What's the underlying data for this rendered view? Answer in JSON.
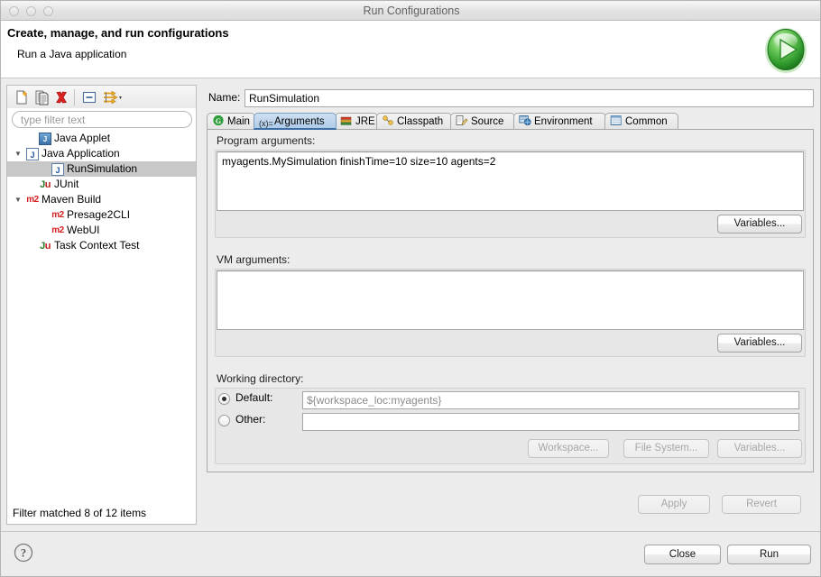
{
  "window": {
    "title": "Run Configurations",
    "traffic_lights": [
      "close",
      "minimize",
      "maximize"
    ]
  },
  "header": {
    "title": "Create, manage, and run configurations",
    "subtitle": "Run a Java application",
    "badge_icon": "run-play-icon"
  },
  "sidebar": {
    "toolbar": [
      {
        "name": "new-configuration-button",
        "icon": "new-document-icon"
      },
      {
        "name": "duplicate-configuration-button",
        "icon": "copy-icon"
      },
      {
        "name": "delete-configuration-button",
        "icon": "red-x-delete-icon"
      },
      {
        "name": "collapse-all-button",
        "icon": "collapse-all-icon"
      },
      {
        "name": "filter-menu-button",
        "icon": "filter-arrows-icon"
      }
    ],
    "filter": {
      "value": "",
      "placeholder": "type filter text"
    },
    "tree": [
      {
        "label": "Java Applet",
        "icon": "java-applet-icon",
        "indent": 1,
        "twisty": "",
        "selected": false
      },
      {
        "label": "Java Application",
        "icon": "java-app-icon",
        "indent": 0,
        "twisty": "▼",
        "selected": false
      },
      {
        "label": "RunSimulation",
        "icon": "java-app-icon",
        "indent": 2,
        "twisty": "",
        "selected": true
      },
      {
        "label": "JUnit",
        "icon": "junit-icon",
        "indent": 1,
        "twisty": "",
        "selected": false
      },
      {
        "label": "Maven Build",
        "icon": "maven-m2-icon",
        "indent": 0,
        "twisty": "▼",
        "selected": false
      },
      {
        "label": "Presage2CLI",
        "icon": "maven-m2-icon",
        "indent": 2,
        "twisty": "",
        "selected": false
      },
      {
        "label": "WebUI",
        "icon": "maven-m2-icon",
        "indent": 2,
        "twisty": "",
        "selected": false
      },
      {
        "label": "Task Context Test",
        "icon": "junit-icon",
        "indent": 1,
        "twisty": "",
        "selected": false
      }
    ],
    "status": "Filter matched 8 of 12 items",
    "help_icon": "question-mark-help-icon"
  },
  "config": {
    "name_label": "Name:",
    "name_value": "RunSimulation",
    "tabs": [
      {
        "label": "Main",
        "icon": "java-main-class-icon",
        "active": false
      },
      {
        "label": "Arguments",
        "icon": "arguments-variable-icon",
        "active": true
      },
      {
        "label": "JRE",
        "icon": "jre-library-icon",
        "active": false
      },
      {
        "label": "Classpath",
        "icon": "classpath-icon",
        "active": false
      },
      {
        "label": "Source",
        "icon": "source-pencil-icon",
        "active": false
      },
      {
        "label": "Environment",
        "icon": "environment-monitor-icon",
        "active": false
      },
      {
        "label": "Common",
        "icon": "common-table-icon",
        "active": false
      }
    ]
  },
  "arguments_tab": {
    "program_arguments": {
      "label": "Program arguments:",
      "value": "myagents.MySimulation finishTime=10 size=10 agents=2",
      "variables_button": "Variables..."
    },
    "vm_arguments": {
      "label": "VM arguments:",
      "value": "",
      "variables_button": "Variables..."
    },
    "working_directory": {
      "label": "Working directory:",
      "default_radio_label": "Default:",
      "default_value": "${workspace_loc:myagents}",
      "default_selected": true,
      "other_radio_label": "Other:",
      "other_value": "",
      "other_selected": false,
      "buttons": [
        {
          "label": "Workspace...",
          "enabled": false
        },
        {
          "label": "File System...",
          "enabled": false
        },
        {
          "label": "Variables...",
          "enabled": false
        }
      ]
    }
  },
  "actions": {
    "apply": {
      "label": "Apply",
      "enabled": false
    },
    "revert": {
      "label": "Revert",
      "enabled": false
    },
    "close": {
      "label": "Close",
      "enabled": true
    },
    "run": {
      "label": "Run",
      "enabled": true
    }
  },
  "colors": {
    "window_bg": "#ececec",
    "panel_bg": "#e7e7e7",
    "field_bg": "#ffffff",
    "active_tab": "#aecbe8",
    "selection": "#c8c8c8",
    "run_green": "#43b43f",
    "delete_red": "#d42020",
    "maven_red": "#d42020",
    "junit_green": "#2b7a2b",
    "placeholder_grey": "#9a9a9a",
    "disabled_grey": "#a7a7a7"
  }
}
